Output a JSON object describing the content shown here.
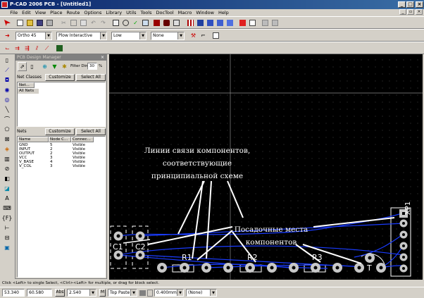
{
  "window": {
    "title": "P-CAD 2006 PCB - [Untitled1]",
    "min": "_",
    "max": "□",
    "close": "×"
  },
  "menu": [
    "File",
    "Edit",
    "View",
    "Place",
    "Route",
    "Options",
    "Library",
    "Utils",
    "Tools",
    "DocTool",
    "Macro",
    "Window",
    "Help"
  ],
  "toolbar2": {
    "ortho": "Ortho 45",
    "mode": "Plow Interactive",
    "level": "Low",
    "none": "None"
  },
  "panel": {
    "title": "PCB Design Manager",
    "filter_label": "Filter Dim:",
    "filter_value": "30",
    "filter_unit": "%",
    "net_classes": {
      "tab": "Net Classes",
      "customize": "Customize",
      "select_all": "Select All",
      "col": "Net...",
      "item": "All Nets"
    },
    "nets": {
      "tab": "Nets",
      "customize": "Customize",
      "select_all": "Select All",
      "cols": [
        "Name",
        "Node C...",
        "Connec..."
      ],
      "rows": [
        [
          "GND",
          "5",
          "Visible"
        ],
        [
          "INPUT",
          "2",
          "Visible"
        ],
        [
          "OUTPUT",
          "2",
          "Visible"
        ],
        [
          "VCC",
          "3",
          "Visible"
        ],
        [
          "V_BASE",
          "4",
          "Visible"
        ],
        [
          "V_COL",
          "3",
          "Visible"
        ]
      ]
    }
  },
  "canvas": {
    "annotation1": [
      "Линии связи компонентов,",
      "соответствующие",
      "принципиальной схеме"
    ],
    "annotation2": [
      "Посадочные места",
      "компонентов"
    ],
    "labels": {
      "c1": "C1",
      "c2": "C2",
      "r1": "R1",
      "r2": "R2",
      "r3": "R3",
      "t": "T",
      "xp1": "XP1"
    }
  },
  "status": "Click <Left> to single Select, <Ctrl><Left> for multiple, or drag for block select.",
  "bottom": {
    "x": "53.340",
    "y": "60.580",
    "abs": "Abs",
    "grid": "2.540",
    "m": "M",
    "layer": "Top Paste",
    "width": "0.400mm",
    "none": "(None)"
  },
  "colors": {
    "board": "#000000",
    "ratsnest": "#1a3cff",
    "pads": "#c8c8c8",
    "annotation": "#ffffff",
    "title_bar": "#0a246a"
  }
}
